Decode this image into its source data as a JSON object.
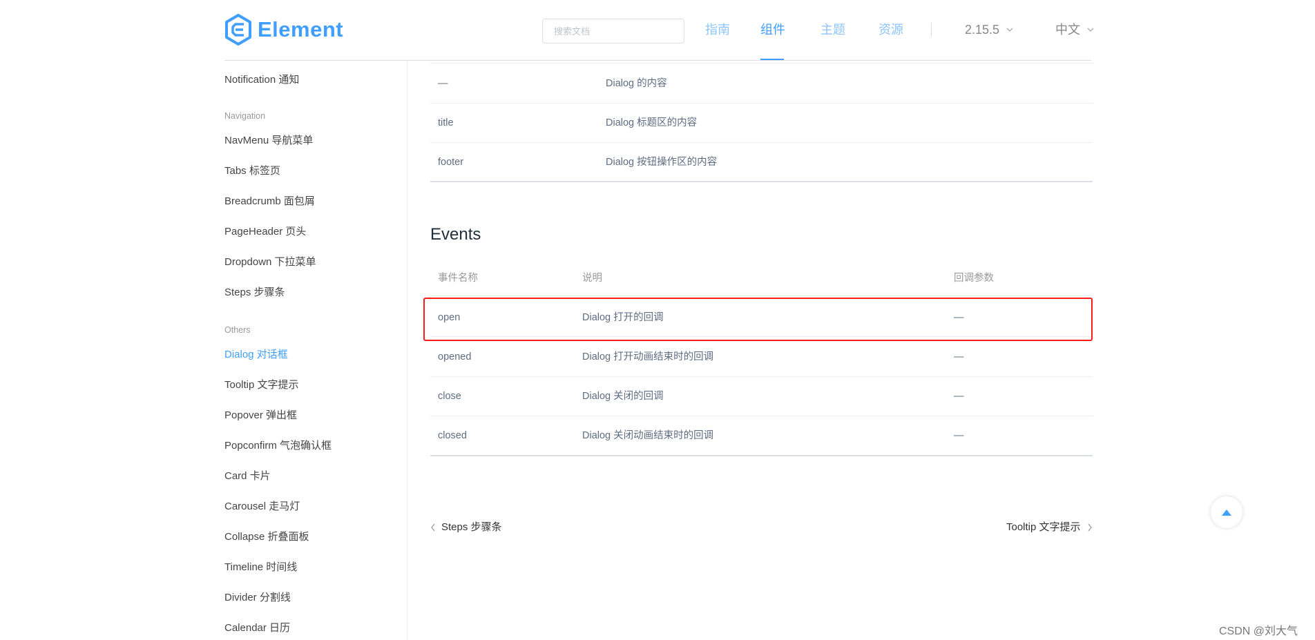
{
  "header": {
    "logo_text": "Element",
    "search_placeholder": "搜索文档",
    "nav": [
      {
        "label": "指南",
        "active": false
      },
      {
        "label": "组件",
        "active": true
      },
      {
        "label": "主题",
        "active": false
      },
      {
        "label": "资源",
        "active": false
      }
    ],
    "version": "2.15.5",
    "language": "中文",
    "accent_color": "#409eff"
  },
  "sidebar": {
    "items": [
      {
        "label": "Notification 通知"
      },
      {
        "group": "Navigation"
      },
      {
        "label": "NavMenu 导航菜单"
      },
      {
        "label": "Tabs 标签页"
      },
      {
        "label": "Breadcrumb 面包屑"
      },
      {
        "label": "PageHeader 页头"
      },
      {
        "label": "Dropdown 下拉菜单"
      },
      {
        "label": "Steps 步骤条"
      },
      {
        "group": "Others"
      },
      {
        "label": "Dialog 对话框",
        "active": true
      },
      {
        "label": "Tooltip 文字提示"
      },
      {
        "label": "Popover 弹出框"
      },
      {
        "label": "Popconfirm 气泡确认框"
      },
      {
        "label": "Card 卡片"
      },
      {
        "label": "Carousel 走马灯"
      },
      {
        "label": "Collapse 折叠面板"
      },
      {
        "label": "Timeline 时间线"
      },
      {
        "label": "Divider 分割线"
      },
      {
        "label": "Calendar 日历"
      }
    ]
  },
  "slots_table": {
    "rows": [
      {
        "name": "—",
        "desc": "Dialog 的内容"
      },
      {
        "name": "title",
        "desc": "Dialog 标题区的内容"
      },
      {
        "name": "footer",
        "desc": "Dialog 按钮操作区的内容"
      }
    ]
  },
  "events": {
    "title": "Events",
    "headers": {
      "name": "事件名称",
      "desc": "说明",
      "params": "回调参数"
    },
    "rows": [
      {
        "name": "open",
        "desc": "Dialog 打开的回调",
        "params": "—",
        "highlighted": true
      },
      {
        "name": "opened",
        "desc": "Dialog 打开动画结束时的回调",
        "params": "—"
      },
      {
        "name": "close",
        "desc": "Dialog 关闭的回调",
        "params": "—"
      },
      {
        "name": "closed",
        "desc": "Dialog 关闭动画结束时的回调",
        "params": "—"
      }
    ],
    "highlight_color": "#ff1a1a"
  },
  "pager": {
    "prev": "Steps 步骤条",
    "next": "Tooltip 文字提示"
  },
  "watermark": "CSDN @刘大气"
}
